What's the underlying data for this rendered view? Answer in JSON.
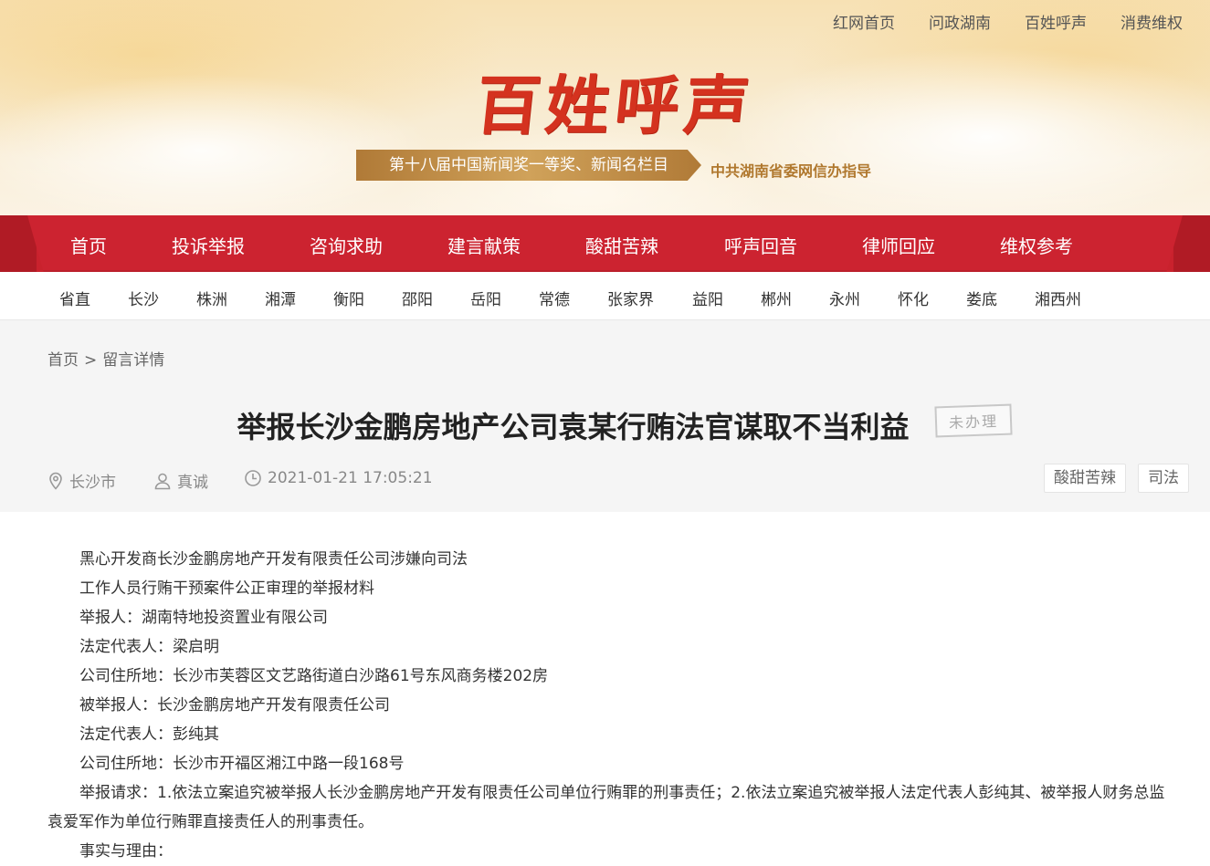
{
  "top_links": [
    "红网首页",
    "问政湖南",
    "百姓呼声",
    "消费维权"
  ],
  "logo": "百姓呼声",
  "award": "第十八届中国新闻奖一等奖、新闻名栏目",
  "guide": "中共湖南省委网信办指导",
  "main_nav": [
    "首页",
    "投诉举报",
    "咨询求助",
    "建言献策",
    "酸甜苦辣",
    "呼声回音",
    "律师回应",
    "维权参考"
  ],
  "regions": [
    "省直",
    "长沙",
    "株洲",
    "湘潭",
    "衡阳",
    "邵阳",
    "岳阳",
    "常德",
    "张家界",
    "益阳",
    "郴州",
    "永州",
    "怀化",
    "娄底",
    "湘西州"
  ],
  "breadcrumb": {
    "home": "首页",
    "separator": ">",
    "current": "留言详情"
  },
  "post": {
    "title": "举报长沙金鹏房地产公司袁某行贿法官谋取不当利益",
    "status": "未办理",
    "location": "长沙市",
    "author": "真诚",
    "datetime": "2021-01-21 17:05:21",
    "tags": [
      "酸甜苦辣",
      "司法"
    ]
  },
  "body": [
    "黑心开发商长沙金鹏房地产开发有限责任公司涉嫌向司法",
    "工作人员行贿干预案件公正审理的举报材料",
    "举报人：湖南特地投资置业有限公司",
    "法定代表人：梁启明",
    "公司住所地：长沙市芙蓉区文艺路街道白沙路61号东风商务楼202房",
    "被举报人：长沙金鹏房地产开发有限责任公司",
    "法定代表人：彭纯其",
    "公司住所地：长沙市开福区湘江中路一段168号",
    "举报请求：1.依法立案追究被举报人长沙金鹏房地产开发有限责任公司单位行贿罪的刑事责任；2.依法立案追究被举报人法定代表人彭纯其、被举报人财务总监袁爱军作为单位行贿罪直接责任人的刑事责任。",
    "事实与理由："
  ]
}
